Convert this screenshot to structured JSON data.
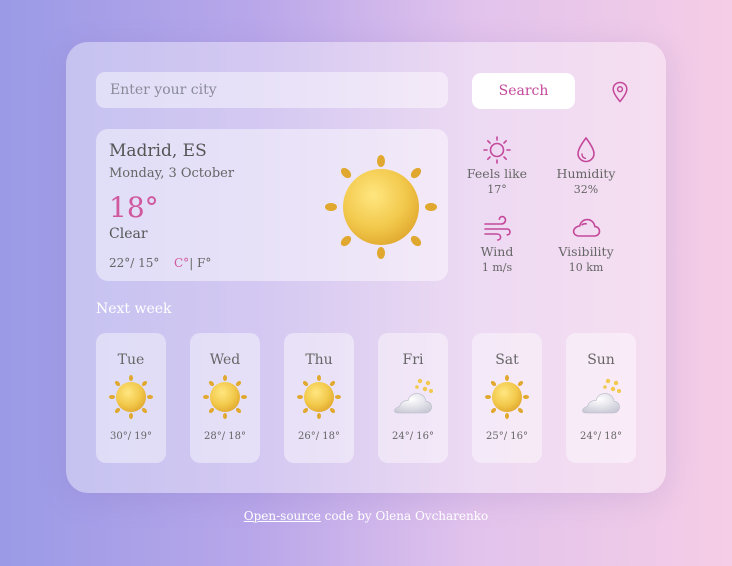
{
  "search": {
    "placeholder": "Enter your city",
    "button_label": "Search"
  },
  "current": {
    "city": "Madrid, ES",
    "date": "Monday, 3 October",
    "temp": "18°",
    "condition": "Clear",
    "range": "22°/ 15°",
    "unit_c": "C°",
    "unit_sep": "| F°"
  },
  "stats": [
    {
      "icon": "sun-icon",
      "label": "Feels like",
      "value": "17°"
    },
    {
      "icon": "droplet-icon",
      "label": "Humidity",
      "value": "32%"
    },
    {
      "icon": "wind-icon",
      "label": "Wind",
      "value": "1 m/s"
    },
    {
      "icon": "cloud-icon",
      "label": "Visibility",
      "value": "10 km"
    }
  ],
  "next_week": {
    "title": "Next week",
    "days": [
      {
        "name": "Tue",
        "icon": "sun-icon",
        "range": "30°/ 19°"
      },
      {
        "name": "Wed",
        "icon": "sun-icon",
        "range": "28°/ 18°"
      },
      {
        "name": "Thu",
        "icon": "sun-icon",
        "range": "26°/ 18°"
      },
      {
        "name": "Fri",
        "icon": "cloud-sun-icon",
        "range": "24°/ 16°"
      },
      {
        "name": "Sat",
        "icon": "sun-icon",
        "range": "25°/ 16°"
      },
      {
        "name": "Sun",
        "icon": "cloud-sun-icon",
        "range": "24°/ 18°"
      }
    ]
  },
  "footer": {
    "link_text": "Open-source",
    "text": " code by Olena Ovcharenko"
  },
  "colors": {
    "accent": "#d0589e",
    "sun": "#f2c94c",
    "icon_stroke": "#c4489a"
  }
}
